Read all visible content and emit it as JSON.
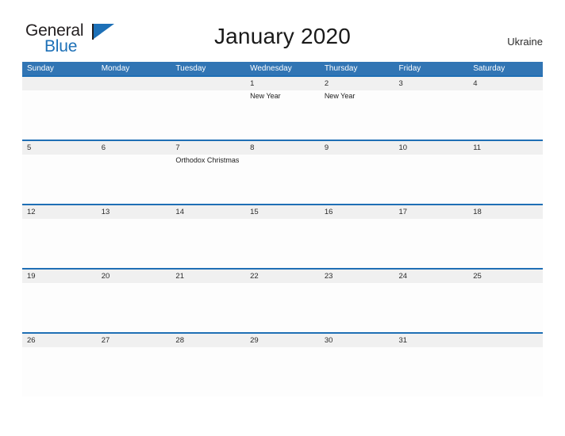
{
  "brand": {
    "name_part1": "General",
    "name_part2": "Blue",
    "flag_icon": "blue-flag-icon",
    "accent_color": "#1d70b7"
  },
  "header": {
    "title": "January 2020",
    "region": "Ukraine"
  },
  "calendar": {
    "header_bg": "#3175b4",
    "date_strip_bg": "#f0f0f0",
    "rule_color": "#1f6fb5",
    "weekdays": [
      "Sunday",
      "Monday",
      "Tuesday",
      "Wednesday",
      "Thursday",
      "Friday",
      "Saturday"
    ],
    "weeks": [
      {
        "days": [
          {
            "date": "",
            "events": []
          },
          {
            "date": "",
            "events": []
          },
          {
            "date": "",
            "events": []
          },
          {
            "date": "1",
            "events": [
              "New Year"
            ]
          },
          {
            "date": "2",
            "events": [
              "New Year"
            ]
          },
          {
            "date": "3",
            "events": []
          },
          {
            "date": "4",
            "events": []
          }
        ]
      },
      {
        "days": [
          {
            "date": "5",
            "events": []
          },
          {
            "date": "6",
            "events": []
          },
          {
            "date": "7",
            "events": [
              "Orthodox Christmas"
            ]
          },
          {
            "date": "8",
            "events": []
          },
          {
            "date": "9",
            "events": []
          },
          {
            "date": "10",
            "events": []
          },
          {
            "date": "11",
            "events": []
          }
        ]
      },
      {
        "days": [
          {
            "date": "12",
            "events": []
          },
          {
            "date": "13",
            "events": []
          },
          {
            "date": "14",
            "events": []
          },
          {
            "date": "15",
            "events": []
          },
          {
            "date": "16",
            "events": []
          },
          {
            "date": "17",
            "events": []
          },
          {
            "date": "18",
            "events": []
          }
        ]
      },
      {
        "days": [
          {
            "date": "19",
            "events": []
          },
          {
            "date": "20",
            "events": []
          },
          {
            "date": "21",
            "events": []
          },
          {
            "date": "22",
            "events": []
          },
          {
            "date": "23",
            "events": []
          },
          {
            "date": "24",
            "events": []
          },
          {
            "date": "25",
            "events": []
          }
        ]
      },
      {
        "days": [
          {
            "date": "26",
            "events": []
          },
          {
            "date": "27",
            "events": []
          },
          {
            "date": "28",
            "events": []
          },
          {
            "date": "29",
            "events": []
          },
          {
            "date": "30",
            "events": []
          },
          {
            "date": "31",
            "events": []
          },
          {
            "date": "",
            "events": []
          }
        ]
      }
    ]
  }
}
